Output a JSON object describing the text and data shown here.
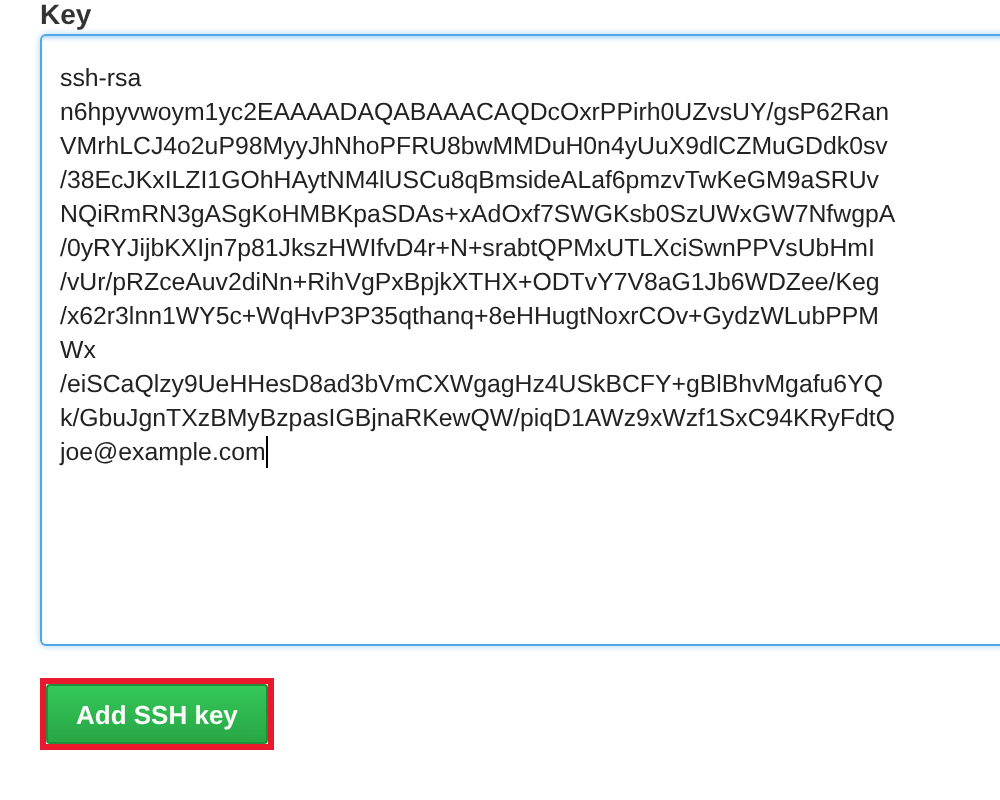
{
  "label": "Key",
  "key_field": {
    "focused": true,
    "lines": [
      "ssh-rsa",
      "n6hpyvwoym1yc2EAAAADAQABAAACAQDcOxrPPirh0UZvsUY/gsP62Ran",
      "VMrhLCJ4o2uP98MyyJhNhoPFRU8bwMMDuH0n4yUuX9dlCZMuGDdk0sv",
      "/38EcJKxILZI1GOhHAytNM4lUSCu8qBmsideALaf6pmzvTwKeGM9aSRUv",
      "NQiRmRN3gASgKoHMBKpaSDAs+xAdOxf7SWGKsb0SzUWxGW7NfwgpA",
      "/0yRYJijbKXIjn7p81JkszHWIfvD4r+N+srabtQPMxUTLXciSwnPPVsUbHmI",
      "/vUr/pRZceAuv2diNn+RihVgPxBpjkXTHX+ODTvY7V8aG1Jb6WDZee/Keg",
      "/x62r3lnn1WY5c+WqHvP3P35qthanq+8eHHugtNoxrCOv+GydzWLubPPM",
      "Wx",
      "/eiSCaQlzy9UeHHesD8ad3bVmCXWgagHz4USkBCFY+gBlBhvMgafu6YQ",
      "k/GbuJgnTXzBMyBzpasIGBjnaRKewQW/piqD1AWz9xWzf1SxC94KRyFdtQ",
      "joe@example.com"
    ]
  },
  "button": {
    "label": "Add SSH key",
    "highlighted": true
  }
}
